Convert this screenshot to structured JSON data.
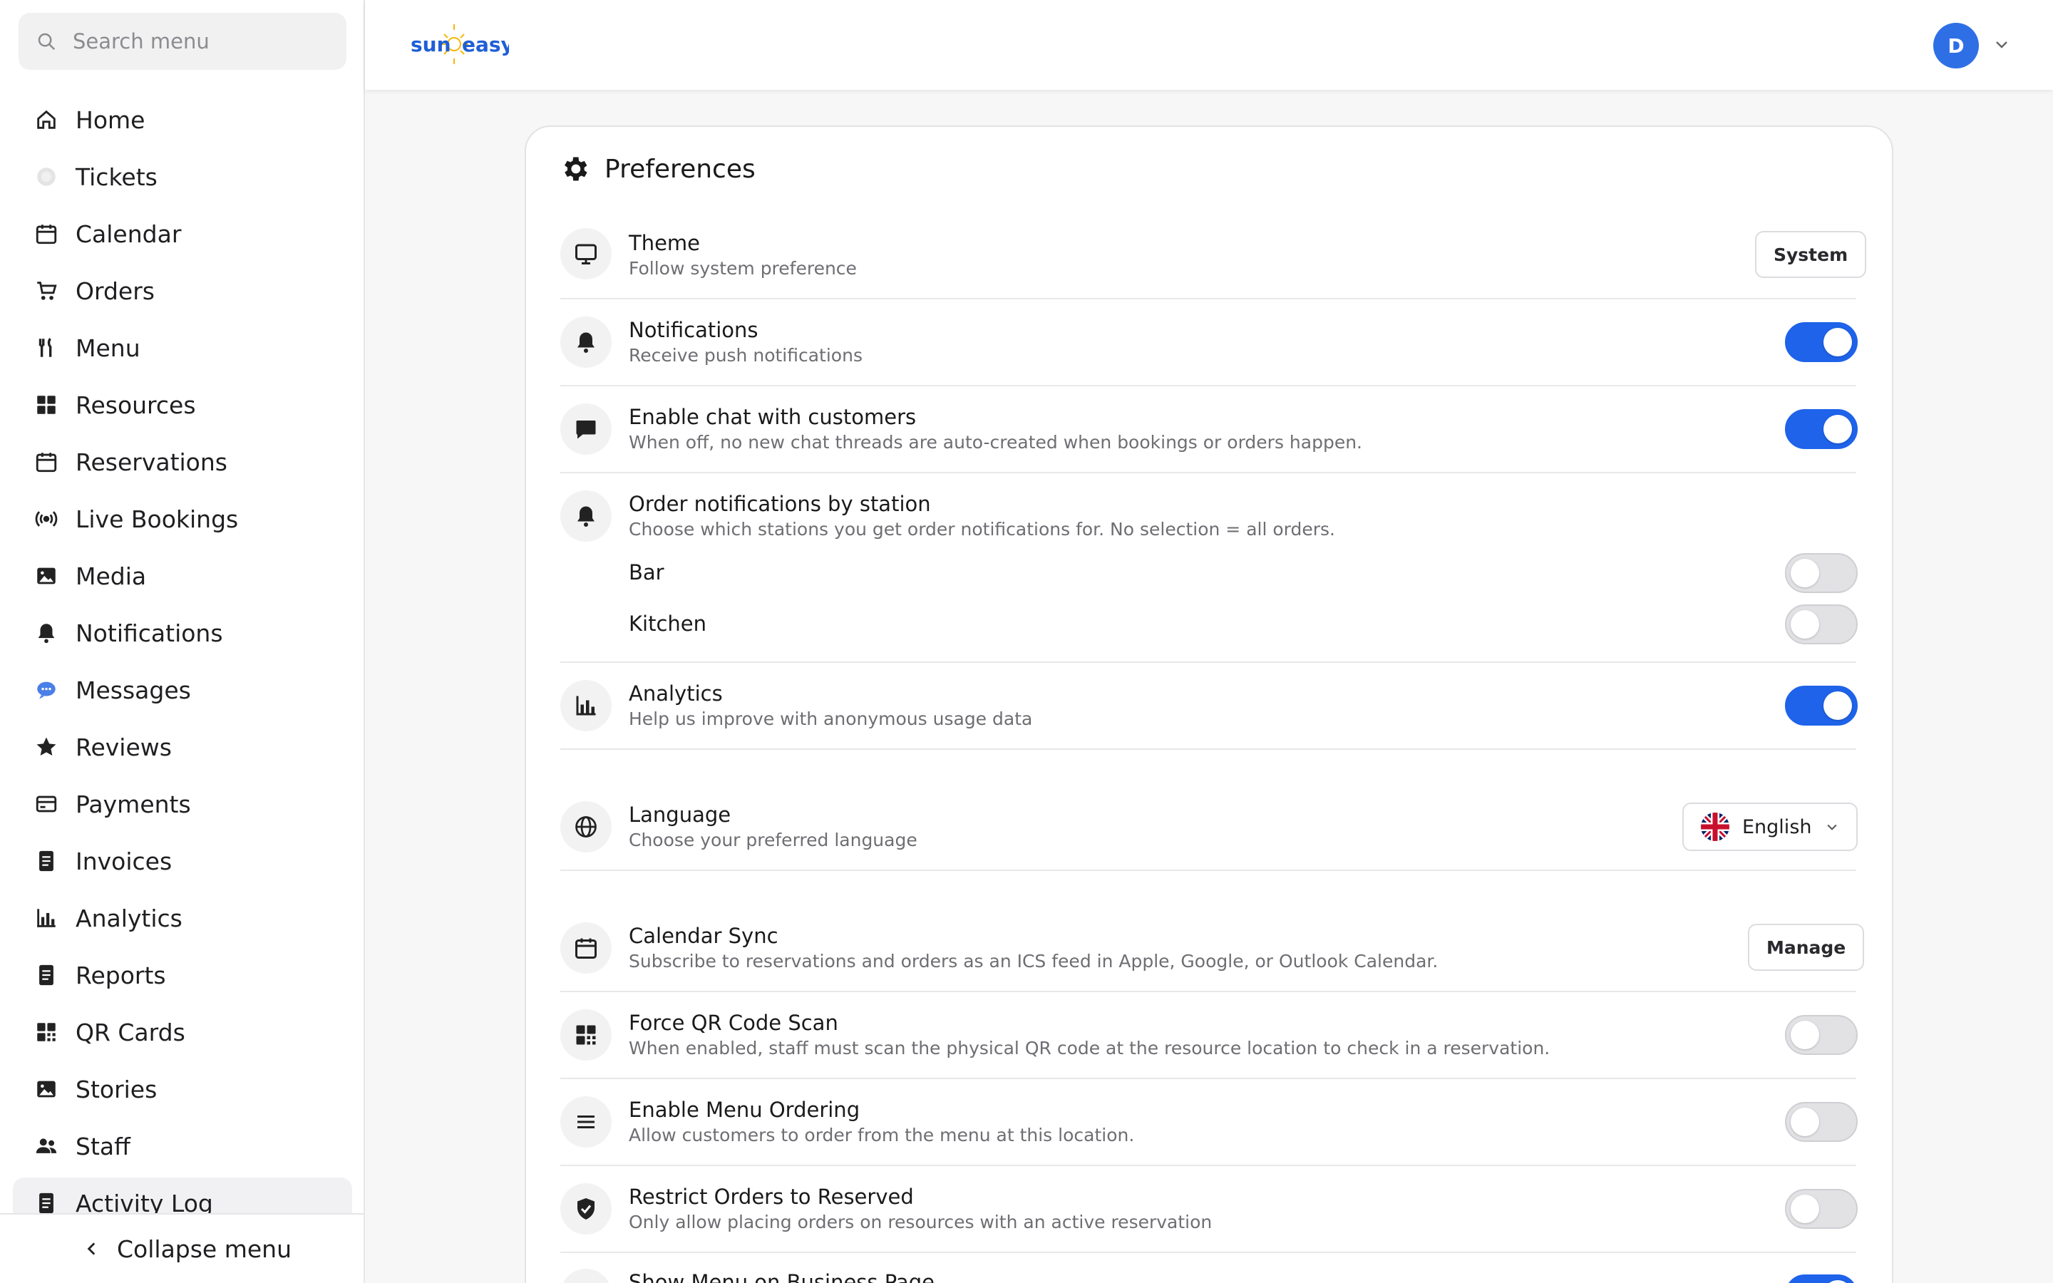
{
  "sidebar": {
    "search_placeholder": "Search menu",
    "items": [
      {
        "label": "Home",
        "icon": "home-icon"
      },
      {
        "label": "Tickets",
        "icon": "tickets-icon"
      },
      {
        "label": "Calendar",
        "icon": "calendar-icon"
      },
      {
        "label": "Orders",
        "icon": "cart-icon"
      },
      {
        "label": "Menu",
        "icon": "utensils-icon"
      },
      {
        "label": "Resources",
        "icon": "grid-icon"
      },
      {
        "label": "Reservations",
        "icon": "calendar-icon"
      },
      {
        "label": "Live Bookings",
        "icon": "broadcast-icon"
      },
      {
        "label": "Media",
        "icon": "image-icon"
      },
      {
        "label": "Notifications",
        "icon": "bell-icon"
      },
      {
        "label": "Messages",
        "icon": "chat-icon"
      },
      {
        "label": "Reviews",
        "icon": "star-icon"
      },
      {
        "label": "Payments",
        "icon": "card-icon"
      },
      {
        "label": "Invoices",
        "icon": "document-icon"
      },
      {
        "label": "Analytics",
        "icon": "bar-chart-icon"
      },
      {
        "label": "Reports",
        "icon": "document-icon"
      },
      {
        "label": "QR Cards",
        "icon": "qr-icon"
      },
      {
        "label": "Stories",
        "icon": "image-icon"
      },
      {
        "label": "Staff",
        "icon": "people-icon"
      },
      {
        "label": "Activity Log",
        "icon": "document-icon"
      }
    ],
    "collapse_label": "Collapse menu"
  },
  "header": {
    "logo_text_left": "sun",
    "logo_text_right": "easy",
    "avatar_initial": "D"
  },
  "preferences": {
    "title": "Preferences",
    "theme": {
      "title": "Theme",
      "subtitle": "Follow system preference",
      "button": "System"
    },
    "notifications": {
      "title": "Notifications",
      "subtitle": "Receive push notifications",
      "enabled": true
    },
    "chat": {
      "title": "Enable chat with customers",
      "subtitle": "When off, no new chat threads are auto-created when bookings or orders happen.",
      "enabled": true
    },
    "order_notifications": {
      "title": "Order notifications by station",
      "subtitle": "Choose which stations you get order notifications for. No selection = all orders.",
      "stations": [
        {
          "label": "Bar",
          "enabled": false
        },
        {
          "label": "Kitchen",
          "enabled": false
        }
      ]
    },
    "analytics": {
      "title": "Analytics",
      "subtitle": "Help us improve with anonymous usage data",
      "enabled": true
    },
    "language": {
      "title": "Language",
      "subtitle": "Choose your preferred language",
      "selected": "English"
    },
    "calendar_sync": {
      "title": "Calendar Sync",
      "subtitle": "Subscribe to reservations and orders as an ICS feed in Apple, Google, or Outlook Calendar.",
      "button": "Manage"
    },
    "force_qr": {
      "title": "Force QR Code Scan",
      "subtitle": "When enabled, staff must scan the physical QR code at the resource location to check in a reservation.",
      "enabled": false
    },
    "menu_ordering": {
      "title": "Enable Menu Ordering",
      "subtitle": "Allow customers to order from the menu at this location.",
      "enabled": false
    },
    "restrict_orders": {
      "title": "Restrict Orders to Reserved",
      "subtitle": "Only allow placing orders on resources with an active reservation",
      "enabled": false
    },
    "show_menu": {
      "title": "Show Menu on Business Page",
      "enabled": true
    }
  },
  "colors": {
    "accent": "#1e63e9",
    "avatar": "#2f6fe6"
  }
}
